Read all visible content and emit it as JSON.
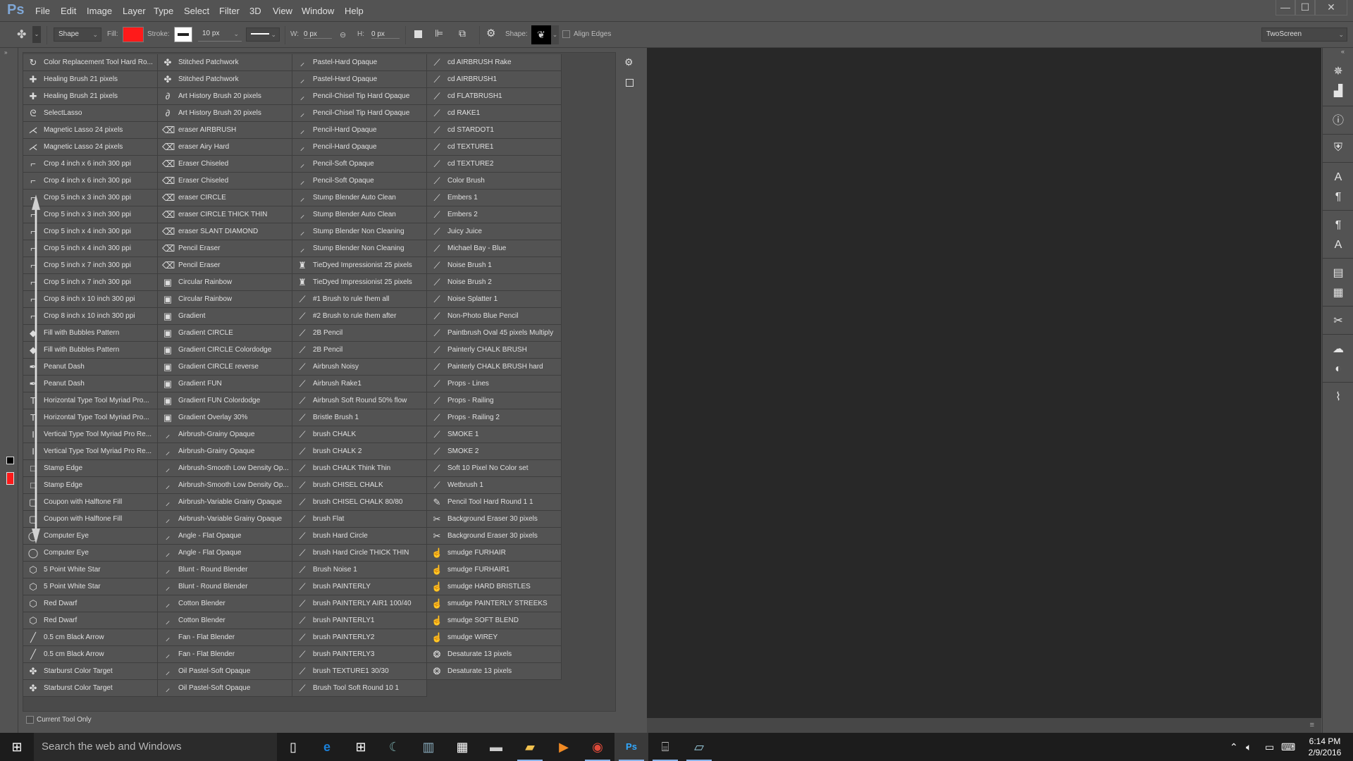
{
  "app": {
    "logo": "Ps",
    "workspace": "TwoScreen"
  },
  "menu": [
    "File",
    "Edit",
    "Image",
    "Layer",
    "Type",
    "Select",
    "Filter",
    "3D",
    "View",
    "Window",
    "Help"
  ],
  "window_controls": {
    "minimize": "—",
    "maximize": "☐",
    "close": "✕"
  },
  "options_bar": {
    "tool_mode": "Shape",
    "fill_label": "Fill:",
    "fill_color": "#ff1a1a",
    "stroke_label": "Stroke:",
    "stroke_width": "10 px",
    "w_label": "W:",
    "w_value": "0 px",
    "h_label": "H:",
    "h_value": "0 px",
    "shape_label": "Shape:",
    "align_edges_label": "Align Edges"
  },
  "tool_presets": {
    "columns": [
      [
        {
          "icon": "color-replacement",
          "label": "Color Replacement Tool Hard Ro..."
        },
        {
          "icon": "healing",
          "label": "Healing Brush 21 pixels"
        },
        {
          "icon": "healing",
          "label": "Healing Brush 21 pixels"
        },
        {
          "icon": "lasso",
          "label": "SelectLasso"
        },
        {
          "icon": "magnetic-lasso",
          "label": "Magnetic Lasso 24 pixels"
        },
        {
          "icon": "magnetic-lasso",
          "label": "Magnetic Lasso 24 pixels"
        },
        {
          "icon": "crop",
          "label": "Crop 4 inch x 6 inch 300 ppi"
        },
        {
          "icon": "crop",
          "label": "Crop 4 inch x 6 inch 300 ppi"
        },
        {
          "icon": "crop",
          "label": "Crop 5 inch x 3 inch 300 ppi"
        },
        {
          "icon": "crop",
          "label": "Crop 5 inch x 3 inch 300 ppi"
        },
        {
          "icon": "crop",
          "label": "Crop 5 inch x 4 inch 300 ppi"
        },
        {
          "icon": "crop",
          "label": "Crop 5 inch x 4 inch 300 ppi"
        },
        {
          "icon": "crop",
          "label": "Crop 5 inch x 7 inch 300 ppi"
        },
        {
          "icon": "crop",
          "label": "Crop 5 inch x 7 inch 300 ppi"
        },
        {
          "icon": "crop",
          "label": "Crop 8 inch x 10 inch 300 ppi"
        },
        {
          "icon": "crop",
          "label": "Crop 8 inch x 10 inch 300 ppi"
        },
        {
          "icon": "paint-bucket",
          "label": "Fill with Bubbles Pattern"
        },
        {
          "icon": "paint-bucket",
          "label": "Fill with Bubbles Pattern"
        },
        {
          "icon": "pen",
          "label": "Peanut Dash"
        },
        {
          "icon": "pen",
          "label": "Peanut Dash"
        },
        {
          "icon": "type",
          "label": "Horizontal Type Tool Myriad Pro..."
        },
        {
          "icon": "type",
          "label": "Horizontal Type Tool Myriad Pro..."
        },
        {
          "icon": "type-vertical",
          "label": "Vertical Type Tool Myriad Pro Re..."
        },
        {
          "icon": "type-vertical",
          "label": "Vertical Type Tool Myriad Pro Re..."
        },
        {
          "icon": "rectangle",
          "label": "Stamp Edge"
        },
        {
          "icon": "rectangle",
          "label": "Stamp Edge"
        },
        {
          "icon": "rounded-rect",
          "label": "Coupon with Halftone Fill"
        },
        {
          "icon": "rounded-rect",
          "label": "Coupon with Halftone Fill"
        },
        {
          "icon": "ellipse",
          "label": "Computer Eye"
        },
        {
          "icon": "ellipse",
          "label": "Computer Eye"
        },
        {
          "icon": "polygon",
          "label": "5 Point White Star"
        },
        {
          "icon": "polygon",
          "label": "5 Point White Star"
        },
        {
          "icon": "polygon",
          "label": "Red Dwarf"
        },
        {
          "icon": "polygon",
          "label": "Red Dwarf"
        },
        {
          "icon": "line",
          "label": "0.5 cm Black Arrow"
        },
        {
          "icon": "line",
          "label": "0.5 cm Black Arrow"
        },
        {
          "icon": "custom-shape",
          "label": "Starburst Color Target"
        },
        {
          "icon": "custom-shape",
          "label": "Starburst Color Target"
        }
      ],
      [
        {
          "icon": "custom-shape",
          "label": "Stitched Patchwork"
        },
        {
          "icon": "custom-shape",
          "label": "Stitched Patchwork"
        },
        {
          "icon": "art-history-brush",
          "label": "Art History Brush 20 pixels"
        },
        {
          "icon": "art-history-brush",
          "label": "Art History Brush 20 pixels"
        },
        {
          "icon": "eraser",
          "label": "eraser AIRBRUSH"
        },
        {
          "icon": "eraser",
          "label": "eraser Airy Hard"
        },
        {
          "icon": "eraser",
          "label": "Eraser Chiseled"
        },
        {
          "icon": "eraser",
          "label": "Eraser Chiseled"
        },
        {
          "icon": "eraser",
          "label": "eraser CIRCLE"
        },
        {
          "icon": "eraser",
          "label": "eraser CIRCLE THICK THIN"
        },
        {
          "icon": "eraser",
          "label": "eraser SLANT DIAMOND"
        },
        {
          "icon": "eraser",
          "label": "Pencil Eraser"
        },
        {
          "icon": "eraser",
          "label": "Pencil Eraser"
        },
        {
          "icon": "gradient",
          "label": "Circular Rainbow"
        },
        {
          "icon": "gradient",
          "label": "Circular Rainbow"
        },
        {
          "icon": "gradient",
          "label": "Gradient"
        },
        {
          "icon": "gradient",
          "label": "Gradient CIRCLE"
        },
        {
          "icon": "gradient",
          "label": "Gradient CIRCLE Colordodge"
        },
        {
          "icon": "gradient",
          "label": "Gradient CIRCLE reverse"
        },
        {
          "icon": "gradient",
          "label": "Gradient FUN"
        },
        {
          "icon": "gradient",
          "label": "Gradient FUN Colordodge"
        },
        {
          "icon": "gradient",
          "label": "Gradient Overlay 30%"
        },
        {
          "icon": "mixer-brush",
          "label": "Airbrush-Grainy Opaque"
        },
        {
          "icon": "mixer-brush",
          "label": "Airbrush-Grainy Opaque"
        },
        {
          "icon": "mixer-brush",
          "label": "Airbrush-Smooth Low Density Op..."
        },
        {
          "icon": "mixer-brush",
          "label": "Airbrush-Smooth Low Density Op..."
        },
        {
          "icon": "mixer-brush",
          "label": "Airbrush-Variable Grainy Opaque"
        },
        {
          "icon": "mixer-brush",
          "label": "Airbrush-Variable Grainy Opaque"
        },
        {
          "icon": "mixer-brush",
          "label": "Angle - Flat Opaque"
        },
        {
          "icon": "mixer-brush",
          "label": "Angle - Flat Opaque"
        },
        {
          "icon": "mixer-brush",
          "label": "Blunt - Round Blender"
        },
        {
          "icon": "mixer-brush",
          "label": "Blunt - Round Blender"
        },
        {
          "icon": "mixer-brush",
          "label": "Cotton Blender"
        },
        {
          "icon": "mixer-brush",
          "label": "Cotton Blender"
        },
        {
          "icon": "mixer-brush",
          "label": "Fan - Flat Blender"
        },
        {
          "icon": "mixer-brush",
          "label": "Fan - Flat Blender"
        },
        {
          "icon": "mixer-brush",
          "label": "Oil Pastel-Soft Opaque"
        },
        {
          "icon": "mixer-brush",
          "label": "Oil Pastel-Soft Opaque"
        }
      ],
      [
        {
          "icon": "mixer-brush",
          "label": "Pastel-Hard Opaque"
        },
        {
          "icon": "mixer-brush",
          "label": "Pastel-Hard Opaque"
        },
        {
          "icon": "mixer-brush",
          "label": "Pencil-Chisel Tip Hard Opaque"
        },
        {
          "icon": "mixer-brush",
          "label": "Pencil-Chisel Tip Hard Opaque"
        },
        {
          "icon": "mixer-brush",
          "label": "Pencil-Hard Opaque"
        },
        {
          "icon": "mixer-brush",
          "label": "Pencil-Hard Opaque"
        },
        {
          "icon": "mixer-brush",
          "label": "Pencil-Soft Opaque"
        },
        {
          "icon": "mixer-brush",
          "label": "Pencil-Soft Opaque"
        },
        {
          "icon": "mixer-brush",
          "label": "Stump Blender Auto Clean"
        },
        {
          "icon": "mixer-brush",
          "label": "Stump Blender Auto Clean"
        },
        {
          "icon": "mixer-brush",
          "label": "Stump Blender Non Cleaning"
        },
        {
          "icon": "mixer-brush",
          "label": "Stump Blender Non Cleaning"
        },
        {
          "icon": "pattern-stamp",
          "label": "TieDyed Impressionist 25 pixels"
        },
        {
          "icon": "pattern-stamp",
          "label": "TieDyed Impressionist 25 pixels"
        },
        {
          "icon": "brush",
          "label": "#1 Brush to rule them all"
        },
        {
          "icon": "brush",
          "label": "#2 Brush to rule them after"
        },
        {
          "icon": "brush",
          "label": "2B Pencil"
        },
        {
          "icon": "brush",
          "label": "2B Pencil"
        },
        {
          "icon": "brush",
          "label": "Airbrush Noisy"
        },
        {
          "icon": "brush",
          "label": "Airbrush Rake1"
        },
        {
          "icon": "brush",
          "label": "Airbrush Soft Round 50% flow"
        },
        {
          "icon": "brush",
          "label": "Bristle Brush 1"
        },
        {
          "icon": "brush",
          "label": "brush CHALK"
        },
        {
          "icon": "brush",
          "label": "brush CHALK 2"
        },
        {
          "icon": "brush",
          "label": "brush CHALK Think Thin"
        },
        {
          "icon": "brush",
          "label": "brush CHISEL CHALK"
        },
        {
          "icon": "brush",
          "label": "brush CHISEL CHALK 80/80"
        },
        {
          "icon": "brush",
          "label": "brush Flat"
        },
        {
          "icon": "brush",
          "label": "brush Hard Circle"
        },
        {
          "icon": "brush",
          "label": "brush Hard Circle THICK THIN"
        },
        {
          "icon": "brush",
          "label": "Brush Noise 1"
        },
        {
          "icon": "brush",
          "label": "brush PAINTERLY"
        },
        {
          "icon": "brush",
          "label": "brush PAINTERLY AIR1 100/40"
        },
        {
          "icon": "brush",
          "label": "brush PAINTERLY1"
        },
        {
          "icon": "brush",
          "label": "brush PAINTERLY2"
        },
        {
          "icon": "brush",
          "label": "brush PAINTERLY3"
        },
        {
          "icon": "brush",
          "label": "brush TEXTURE1 30/30"
        },
        {
          "icon": "brush",
          "label": "Brush Tool Soft Round 10 1"
        }
      ],
      [
        {
          "icon": "brush",
          "label": "cd AIRBRUSH Rake"
        },
        {
          "icon": "brush",
          "label": "cd AIRBRUSH1"
        },
        {
          "icon": "brush",
          "label": "cd FLATBRUSH1"
        },
        {
          "icon": "brush",
          "label": "cd RAKE1"
        },
        {
          "icon": "brush",
          "label": "cd STARDOT1"
        },
        {
          "icon": "brush",
          "label": "cd TEXTURE1"
        },
        {
          "icon": "brush",
          "label": "cd TEXTURE2"
        },
        {
          "icon": "brush",
          "label": "Color Brush"
        },
        {
          "icon": "brush",
          "label": "Embers 1"
        },
        {
          "icon": "brush",
          "label": "Embers 2"
        },
        {
          "icon": "brush",
          "label": "Juicy Juice"
        },
        {
          "icon": "brush",
          "label": "Michael Bay - Blue"
        },
        {
          "icon": "brush",
          "label": "Noise Brush 1"
        },
        {
          "icon": "brush",
          "label": "Noise Brush 2"
        },
        {
          "icon": "brush",
          "label": "Noise Splatter 1"
        },
        {
          "icon": "brush",
          "label": "Non-Photo Blue Pencil"
        },
        {
          "icon": "brush",
          "label": "Paintbrush Oval 45 pixels Multiply"
        },
        {
          "icon": "brush",
          "label": "Painterly CHALK BRUSH"
        },
        {
          "icon": "brush",
          "label": "Painterly CHALK BRUSH hard"
        },
        {
          "icon": "brush",
          "label": "Props - Lines"
        },
        {
          "icon": "brush",
          "label": "Props - Railing"
        },
        {
          "icon": "brush",
          "label": "Props - Railing 2"
        },
        {
          "icon": "brush",
          "label": "SMOKE 1"
        },
        {
          "icon": "brush",
          "label": "SMOKE 2"
        },
        {
          "icon": "brush",
          "label": "Soft  10 Pixel No Color set"
        },
        {
          "icon": "brush",
          "label": "Wetbrush 1"
        },
        {
          "icon": "pencil",
          "label": "Pencil Tool Hard Round 1 1"
        },
        {
          "icon": "background-eraser",
          "label": "Background Eraser 30 pixels"
        },
        {
          "icon": "background-eraser",
          "label": "Background Eraser 30 pixels"
        },
        {
          "icon": "smudge",
          "label": "smudge FURHAIR"
        },
        {
          "icon": "smudge",
          "label": "smudge FURHAIR1"
        },
        {
          "icon": "smudge",
          "label": "smudge HARD BRISTLES"
        },
        {
          "icon": "smudge",
          "label": "smudge PAINTERLY STREEKS"
        },
        {
          "icon": "smudge",
          "label": "smudge SOFT BLEND"
        },
        {
          "icon": "smudge",
          "label": "smudge WIREY"
        },
        {
          "icon": "sponge",
          "label": "Desaturate 13 pixels"
        },
        {
          "icon": "sponge",
          "label": "Desaturate 13 pixels"
        }
      ]
    ],
    "current_tool_only_label": "Current Tool Only",
    "current_tool_only_checked": false
  },
  "right_dock": [
    "navigator-icon",
    "histogram-icon",
    "info-icon",
    "tool-presets-icon",
    "character-icon",
    "paragraph-icon",
    "paragraph-styles-icon",
    "character-styles-icon",
    "properties-icon",
    "notes-icon",
    "tools-icon",
    "creative-cloud-icon",
    "adjustments-icon",
    "history-icon"
  ],
  "taskbar": {
    "search_placeholder": "Search the web and Windows",
    "apps": [
      "task-view",
      "edge",
      "store",
      "app-crescent",
      "calculator-blue",
      "calculator",
      "command-prompt",
      "file-explorer",
      "media-player",
      "chrome",
      "photoshop",
      "performance-monitor",
      "notepad"
    ],
    "time": "6:14 PM",
    "date": "2/9/2016"
  },
  "icon_glyphs": {
    "color-replacement": "↻",
    "healing": "✚",
    "lasso": "ᘓ",
    "magnetic-lasso": "⋌",
    "crop": "⌐",
    "paint-bucket": "◆",
    "pen": "✒",
    "type": "T",
    "type-vertical": "I",
    "rectangle": "□",
    "rounded-rect": "▢",
    "ellipse": "◯",
    "polygon": "⬡",
    "line": "╱",
    "custom-shape": "✤",
    "art-history-brush": "∂",
    "eraser": "⌫",
    "gradient": "▣",
    "mixer-brush": "⸝",
    "pattern-stamp": "♜",
    "brush": "⟋",
    "pencil": "✎",
    "background-eraser": "✂",
    "smudge": "☝",
    "sponge": "❂"
  }
}
